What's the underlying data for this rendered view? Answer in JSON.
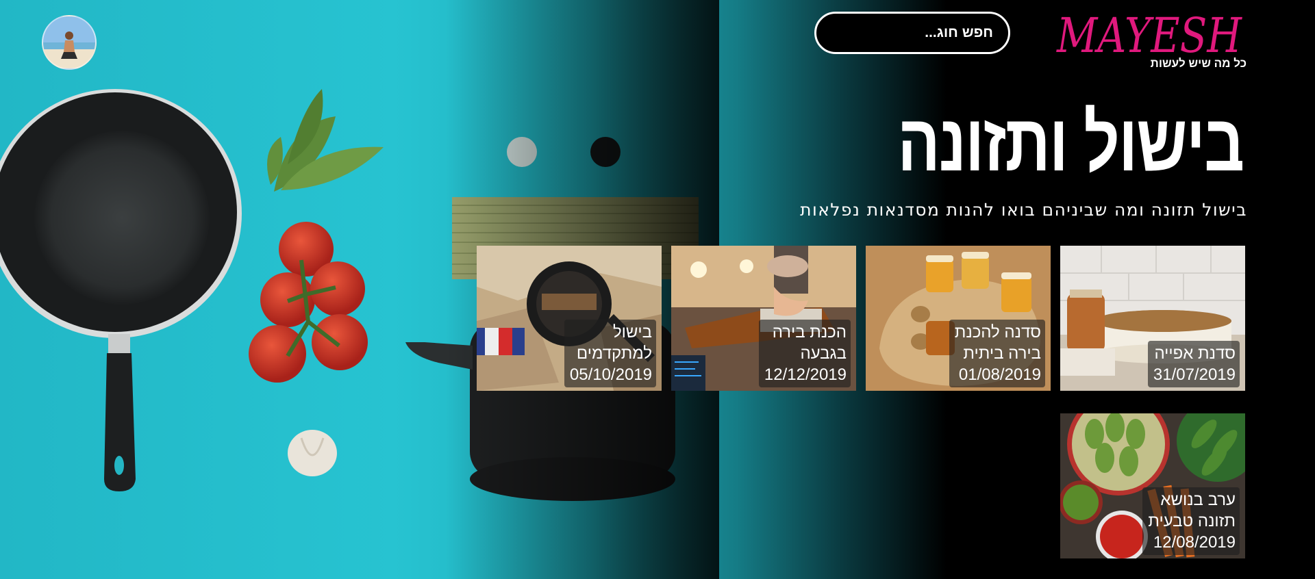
{
  "header": {
    "logo_text": "MAYESH",
    "logo_tagline": "כל מה שיש לעשות",
    "search_placeholder": "חפש חוג...",
    "avatar_label": "profile-avatar"
  },
  "hero": {
    "title": "בישול ותזונה",
    "subtitle": "בישול תזונה ומה שביניהם בואו להנות מסדנאות נפלאות"
  },
  "cards": [
    {
      "title": "סדנת אפייה",
      "date": "31/07/2019"
    },
    {
      "title": "סדנה להכנת\nבירה ביתית",
      "date": "01/08/2019"
    },
    {
      "title": "הכנת בירה\nבגבעה",
      "date": "12/12/2019"
    },
    {
      "title": "בישול\nלמתקדמים",
      "date": "05/10/2019"
    },
    {
      "title": "ערב בנושא\nתזונה טבעית",
      "date": "12/08/2019"
    }
  ],
  "colors": {
    "background": "#000000",
    "hero_teal": "#27c3d1",
    "logo_pink": "#e0197d",
    "text": "#ffffff",
    "caption_bg": "rgba(30,30,30,0.62)"
  },
  "icons": {
    "avatar": "user-photo-icon"
  }
}
